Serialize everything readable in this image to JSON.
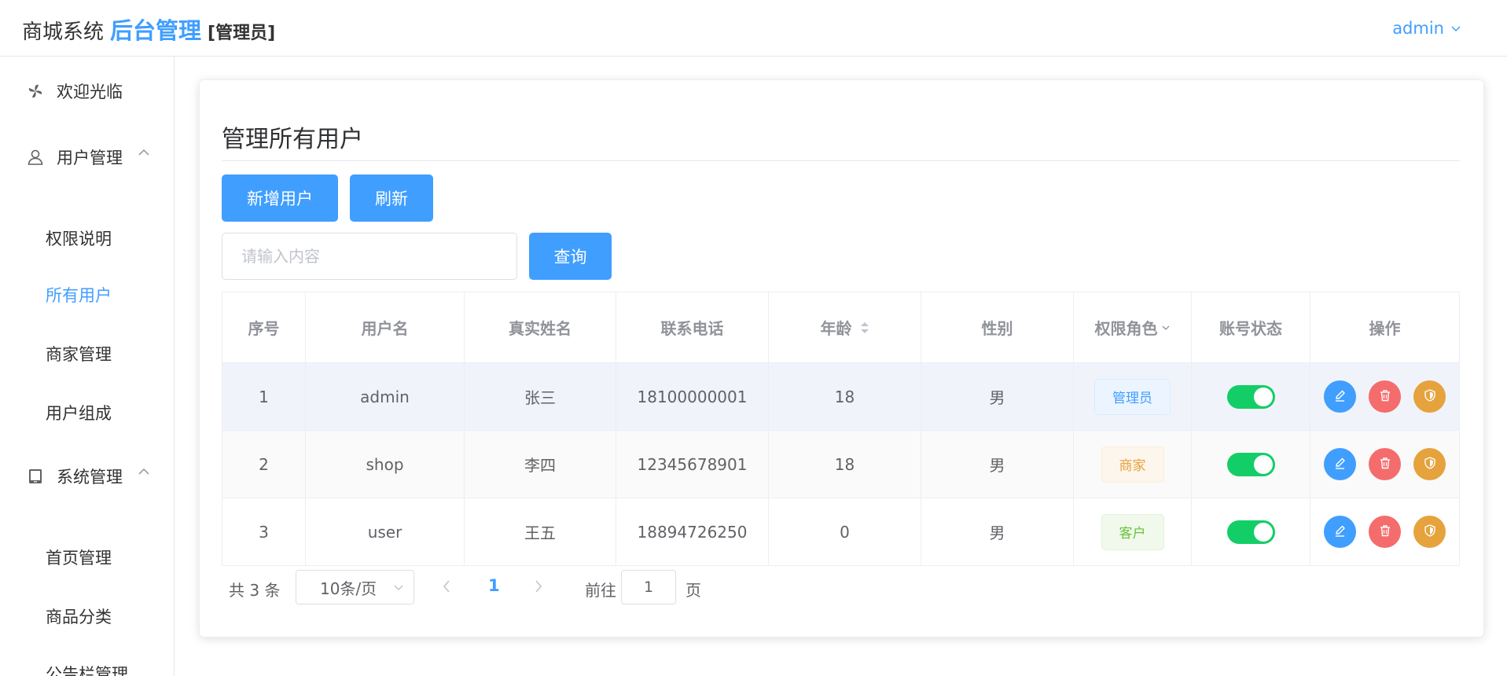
{
  "header": {
    "brand_prefix": "商城系统",
    "brand_main": "后台管理",
    "brand_role": "[管理员]",
    "user_name": "admin"
  },
  "sidebar": {
    "welcome": "欢迎光临",
    "user_group": "用户管理",
    "user_items": [
      "权限说明",
      "所有用户",
      "商家管理",
      "用户组成"
    ],
    "system_group": "系统管理",
    "system_items": [
      "首页管理",
      "商品分类",
      "公告栏管理"
    ],
    "active_item": "所有用户"
  },
  "main": {
    "title": "管理所有用户",
    "add_button": "新增用户",
    "refresh_button": "刷新",
    "search_placeholder": "请输入内容",
    "search_button": "查询",
    "table": {
      "headers": [
        "序号",
        "用户名",
        "真实姓名",
        "联系电话",
        "年龄",
        "性别",
        "权限角色",
        "账号状态",
        "操作"
      ],
      "rows": [
        {
          "index": "1",
          "username": "admin",
          "real_name": "张三",
          "phone": "18100000001",
          "age": "18",
          "gender": "男",
          "role": "管理员",
          "role_color": "#409eff",
          "role_bg": "#ecf5ff",
          "role_border": "#d9ecff",
          "status_on": true
        },
        {
          "index": "2",
          "username": "shop",
          "real_name": "李四",
          "phone": "12345678901",
          "age": "18",
          "gender": "男",
          "role": "商家",
          "role_color": "#e6a23c",
          "role_bg": "#fdf6ec",
          "role_border": "#faecd8",
          "status_on": true
        },
        {
          "index": "3",
          "username": "user",
          "real_name": "王五",
          "phone": "18894726250",
          "age": "0",
          "gender": "男",
          "role": "客户",
          "role_color": "#67c23a",
          "role_bg": "#f0f9eb",
          "role_border": "#e1f3d8",
          "status_on": true
        }
      ],
      "row_backgrounds": [
        "#f0f4fa",
        "#fafafa",
        "#ffffff"
      ]
    },
    "pagination": {
      "total": "共 3 条",
      "page_size": "10条/页",
      "current_page": "1",
      "goto_label": "前往",
      "goto_value": "1",
      "page_unit": "页"
    }
  },
  "colors": {
    "primary": "#409eff",
    "danger": "#f56c6c",
    "warning": "#e6a23c",
    "switch_on": "#13ce66"
  }
}
